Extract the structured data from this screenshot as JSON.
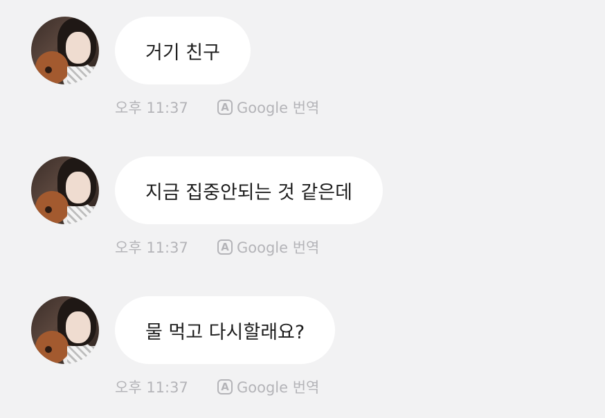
{
  "messages": [
    {
      "text": "거기 친구",
      "time": "오후 11:37",
      "translate_label": "Google 번역",
      "translate_icon": "A"
    },
    {
      "text": "지금 집중안되는 것 같은데",
      "time": "오후 11:37",
      "translate_label": "Google 번역",
      "translate_icon": "A"
    },
    {
      "text": "물 먹고 다시할래요?",
      "time": "오후 11:37",
      "translate_label": "Google 번역",
      "translate_icon": "A"
    }
  ],
  "colors": {
    "background": "#f2f2f3",
    "bubble": "#ffffff",
    "meta_text": "#b4b4b8",
    "message_text": "#1d1d1d"
  }
}
